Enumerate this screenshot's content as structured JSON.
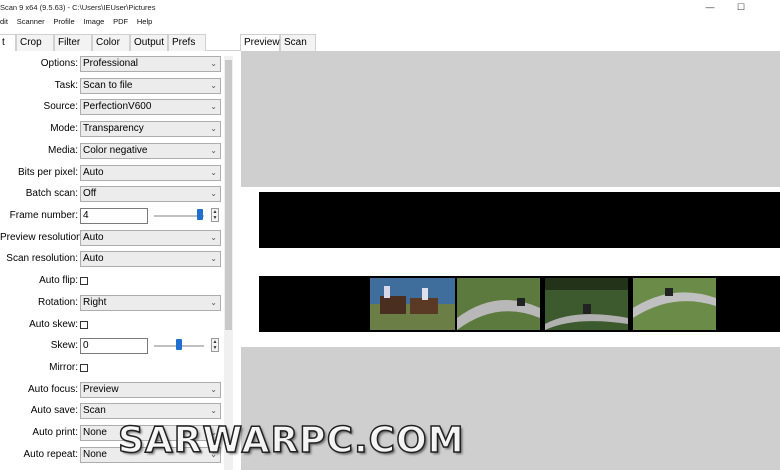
{
  "window": {
    "title": "Scan 9 x64 (9.5.63) - C:\\Users\\IEUser\\Pictures",
    "minimize": "—",
    "maximize": "☐"
  },
  "menu": [
    "dit",
    "Scanner",
    "Profile",
    "Image",
    "PDF",
    "Help"
  ],
  "left_tabs": [
    "t",
    "Crop",
    "Filter",
    "Color",
    "Output",
    "Prefs"
  ],
  "right_tabs": [
    "Preview",
    "Scan"
  ],
  "settings": {
    "options": {
      "label": "Options:",
      "value": "Professional"
    },
    "task": {
      "label": "Task:",
      "value": "Scan to file"
    },
    "source": {
      "label": "Source:",
      "value": "PerfectionV600"
    },
    "mode": {
      "label": "Mode:",
      "value": "Transparency"
    },
    "media": {
      "label": "Media:",
      "value": "Color negative"
    },
    "bits": {
      "label": "Bits per pixel:",
      "value": "Auto"
    },
    "batch": {
      "label": "Batch scan:",
      "value": "Off"
    },
    "frame_number": {
      "label": "Frame number:",
      "value": "4"
    },
    "preview_res": {
      "label": "Preview resolution:",
      "value": "Auto"
    },
    "scan_res": {
      "label": "Scan resolution:",
      "value": "Auto"
    },
    "auto_flip": {
      "label": "Auto flip:",
      "checked": false
    },
    "rotation": {
      "label": "Rotation:",
      "value": "Right"
    },
    "auto_skew": {
      "label": "Auto skew:",
      "checked": false
    },
    "skew": {
      "label": "Skew:",
      "value": "0"
    },
    "mirror": {
      "label": "Mirror:",
      "checked": false
    },
    "auto_focus": {
      "label": "Auto focus:",
      "value": "Preview"
    },
    "auto_save": {
      "label": "Auto save:",
      "value": "Scan"
    },
    "auto_print": {
      "label": "Auto print:",
      "value": "None"
    },
    "auto_repeat": {
      "label": "Auto repeat:",
      "value": "None"
    }
  },
  "watermark": "SARWARPC.COM",
  "icons": {
    "dropdown": "chevron-down-icon",
    "spin": "spin-arrows-icon"
  },
  "colors": {
    "accent": "#1f6fd1",
    "preview_bg": "#cfcfcf",
    "film": "#000000"
  }
}
